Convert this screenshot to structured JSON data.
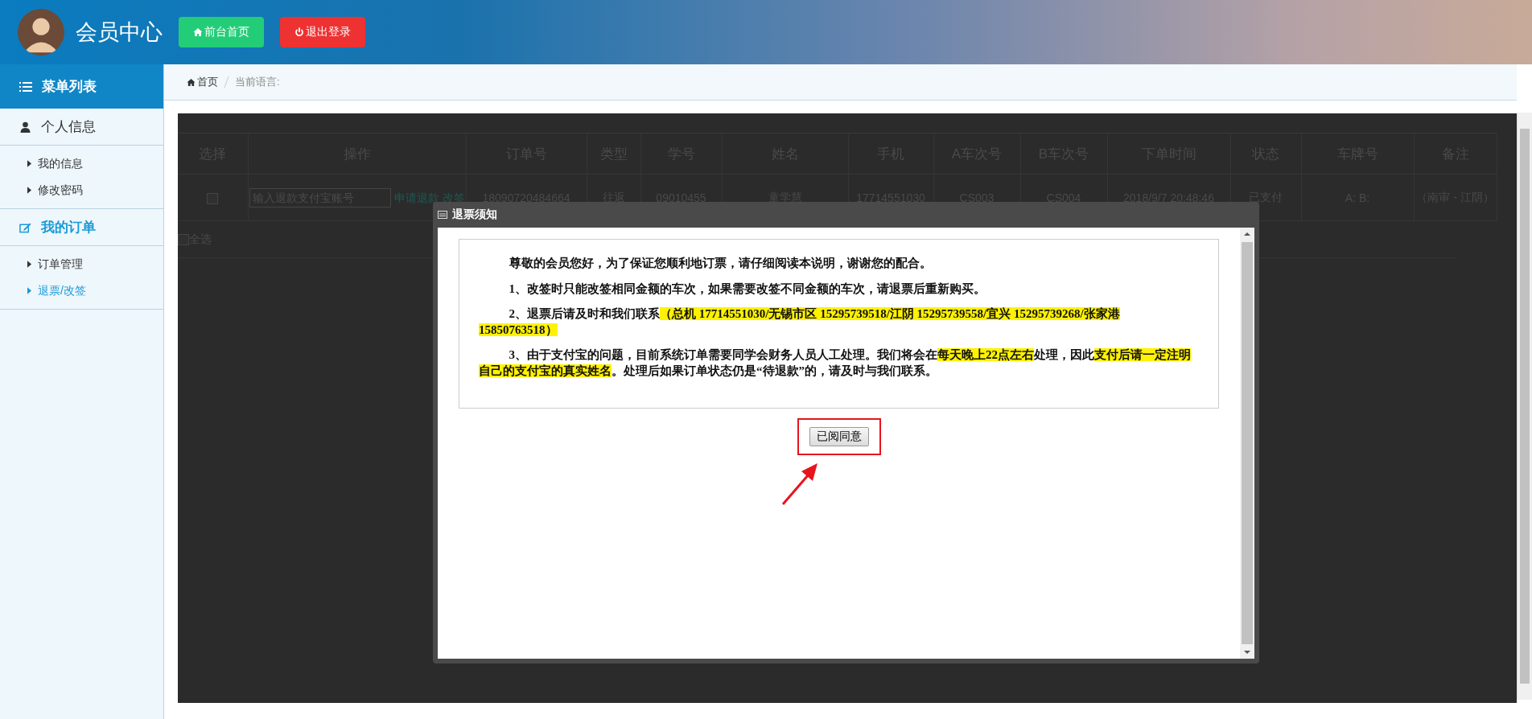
{
  "header": {
    "title": "会员中心",
    "buttons": [
      {
        "label": "前台首页",
        "kind": "home"
      },
      {
        "label": "退出登录",
        "kind": "logout"
      }
    ]
  },
  "sidebar": {
    "title": "菜单列表",
    "groups": [
      {
        "title": "个人信息",
        "selected": false,
        "items": [
          {
            "label": "我的信息",
            "selected": false
          },
          {
            "label": "修改密码",
            "selected": false
          }
        ]
      },
      {
        "title": "我的订单",
        "selected": true,
        "items": [
          {
            "label": "订单管理",
            "selected": false
          },
          {
            "label": "退票/改签",
            "selected": true
          }
        ]
      }
    ]
  },
  "breadcrumb": {
    "home": "首页",
    "current": "当前语言:"
  },
  "table": {
    "columns": [
      "选择",
      "操作",
      "订单号",
      "类型",
      "学号",
      "姓名",
      "手机",
      "A车次号",
      "B车次号",
      "下单时间",
      "状态",
      "车牌号",
      "备注"
    ],
    "rows": [
      {
        "cells": [
          {
            "kind": "checkbox",
            "checked": false
          },
          {
            "kind": "operation",
            "placeholder": "输入退款支付宝账号",
            "actions": [
              "申请退款",
              "改签"
            ]
          },
          {
            "kind": "text",
            "text": "18090720484664"
          },
          {
            "kind": "text",
            "text": "往返"
          },
          {
            "kind": "text",
            "text": "09010455"
          },
          {
            "kind": "text",
            "text": "童学慧"
          },
          {
            "kind": "text",
            "text": "17714551030"
          },
          {
            "kind": "text",
            "text": "CS003"
          },
          {
            "kind": "text",
            "text": "CS004"
          },
          {
            "kind": "text",
            "text": "2018/9/7 20:48:46"
          },
          {
            "kind": "text",
            "text": "已支付"
          },
          {
            "kind": "text",
            "text": "A: B:"
          },
          {
            "kind": "text",
            "text": "（南审 - 江阴）"
          }
        ]
      }
    ],
    "select_all": {
      "label": "全选",
      "checked": false
    }
  },
  "dialog": {
    "title": "退票须知",
    "paragraphs": [
      [
        {
          "text": "尊敬的会员您好，为了保证您顺利地订票，请仔细阅读本说明，谢谢您的配合。",
          "highlighted": false
        }
      ],
      [
        {
          "text": "1、改签时只能改签相同金额的车次，如果需要改签不同金额的车次，请退票后重新购买。",
          "highlighted": false
        }
      ],
      [
        {
          "text": "2、退票后请及时和我们联系",
          "highlighted": false
        },
        {
          "text": "（总机 17714551030/无锡市区 15295739518/江阴 15295739558/宜兴 15295739268/张家港 15850763518）",
          "highlighted": true
        }
      ],
      [
        {
          "text": "3、由于支付宝的问题，目前系统订单需要同学会财务人员人工处理。我们将会在",
          "highlighted": false
        },
        {
          "text": "每天晚上22点左右",
          "highlighted": true
        },
        {
          "text": "处理，因此",
          "highlighted": false
        },
        {
          "text": "支付后请一定注明自己的支付宝的真实姓名",
          "highlighted": true
        },
        {
          "text": "。处理后如果订单状态仍是“待退款”的，请及时与我们联系。",
          "highlighted": false
        }
      ]
    ],
    "button": "已阅同意"
  }
}
